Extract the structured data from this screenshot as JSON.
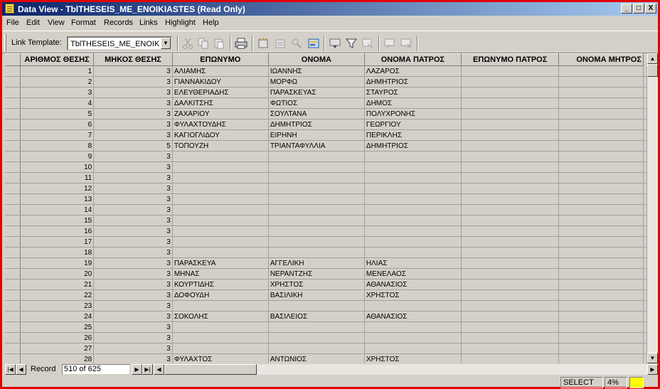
{
  "window": {
    "title": "Data View - TblTHESEIS_ME_ENOIKIASTES (Read Only)",
    "buttons": [
      "_",
      "□",
      "X"
    ]
  },
  "menu": [
    "File",
    "Edit",
    "View",
    "Format",
    "Records",
    "Links",
    "Highlight",
    "Help"
  ],
  "toolbar": {
    "link_template_label": "Link Template:",
    "link_template_value": "TblTHESEIS_ME_ENOIKIAS"
  },
  "columns": [
    "ΑΡΙΘΜΟΣ ΘΕΣΗΣ",
    "ΜΗΚΟΣ ΘΕΣΗΣ",
    "ΕΠΩΝΥΜΟ",
    "ΟΝΟΜΑ",
    "ΟΝΟΜΑ ΠΑΤΡΟΣ",
    "ΕΠΩΝΥΜΟ ΠΑΤΡΟΣ",
    "ΟΝΟΜΑ ΜΗΤΡΟΣ"
  ],
  "rows": [
    [
      "1",
      "3",
      "ΑΛΙΑΜΗΣ",
      "ΙΩΑΝΝΗΣ",
      "ΛΑΖΑΡΟΣ",
      "",
      ""
    ],
    [
      "2",
      "3",
      "ΓΙΑΝΝΑΚΙΔΟΥ",
      "ΜΟΡΦΩ",
      "ΔΗΜΗΤΡΙΟΣ",
      "",
      ""
    ],
    [
      "3",
      "3",
      "ΕΛΕΥΘΕΡΙΑΔΗΣ",
      "ΠΑΡΑΣΚΕΥΑΣ",
      "ΣΤΑΥΡΟΣ",
      "",
      ""
    ],
    [
      "4",
      "3",
      "ΔΑΛΚΙΤΣΗΣ",
      "ΦΩΤΙΟΣ",
      "ΔΗΜΟΣ",
      "",
      ""
    ],
    [
      "5",
      "3",
      "ΖΑΧΑΡΙΟΥ",
      "ΣΟΥΛΤΑΝΑ",
      "ΠΟΛΥΧΡΟΝΗΣ",
      "",
      ""
    ],
    [
      "6",
      "3",
      "ΦΥΛΑΧΤΟΥΔΗΣ",
      "ΔΗΜΗΤΡΙΟΣ",
      "ΓΕΩΡΓΙΟΥ",
      "",
      ""
    ],
    [
      "7",
      "3",
      "ΚΑΓΙΟΓΛΙΔΟΥ",
      "ΕΙΡΗΝΗ",
      "ΠΕΡΙΚΛΗΣ",
      "",
      ""
    ],
    [
      "8",
      "5",
      "ΤΟΠΟΥΖΗ",
      "ΤΡΙΑΝΤΑΦΥΛΛΙΑ",
      "ΔΗΜΗΤΡΙΟΣ",
      "",
      ""
    ],
    [
      "9",
      "3",
      "",
      "",
      "",
      "",
      ""
    ],
    [
      "10",
      "3",
      "",
      "",
      "",
      "",
      ""
    ],
    [
      "11",
      "3",
      "",
      "",
      "",
      "",
      ""
    ],
    [
      "12",
      "3",
      "",
      "",
      "",
      "",
      ""
    ],
    [
      "13",
      "3",
      "",
      "",
      "",
      "",
      ""
    ],
    [
      "14",
      "3",
      "",
      "",
      "",
      "",
      ""
    ],
    [
      "15",
      "3",
      "",
      "",
      "",
      "",
      ""
    ],
    [
      "16",
      "3",
      "",
      "",
      "",
      "",
      ""
    ],
    [
      "17",
      "3",
      "",
      "",
      "",
      "",
      ""
    ],
    [
      "18",
      "3",
      "",
      "",
      "",
      "",
      ""
    ],
    [
      "19",
      "3",
      "ΠΑΡΑΣΚΕΥΑ",
      "ΑΓΓΕΛΙΚΗ",
      "ΗΛΙΑΣ",
      "",
      ""
    ],
    [
      "20",
      "3",
      "ΜΗΝΑΣ",
      "ΝΕΡΑΝΤΖΗΣ",
      "ΜΕΝΕΛΑΟΣ",
      "",
      ""
    ],
    [
      "21",
      "3",
      "ΚΟΥΡΤΙΔΗΣ",
      "ΧΡΗΣΤΟΣ",
      "ΑΘΑΝΑΣΙΟΣ",
      "",
      ""
    ],
    [
      "22",
      "3",
      "ΔΟΦΟΥΔΗ",
      "ΒΑΣΙΛΙΚΗ",
      "ΧΡΗΣΤΟΣ",
      "",
      ""
    ],
    [
      "23",
      "3",
      "",
      "",
      "",
      "",
      ""
    ],
    [
      "24",
      "3",
      "ΣΟΚΟΛΗΣ",
      "ΒΑΣΙΛΕΙΟΣ",
      "ΑΘΑΝΑΣΙΟΣ",
      "",
      ""
    ],
    [
      "25",
      "3",
      "",
      "",
      "",
      "",
      ""
    ],
    [
      "26",
      "3",
      "",
      "",
      "",
      "",
      ""
    ],
    [
      "27",
      "3",
      "",
      "",
      "",
      "",
      ""
    ],
    [
      "28",
      "3",
      "ΦΥΛΑΧΤΟΣ",
      "ΑΝΤΩΝΙΟΣ",
      "ΧΡΗΣΤΟΣ",
      "",
      ""
    ]
  ],
  "record_nav": {
    "label": "Record",
    "position": "510 of 625"
  },
  "status": {
    "mode": "SELECT",
    "zoom": "4%",
    "indicator_color": "#ffff00"
  }
}
